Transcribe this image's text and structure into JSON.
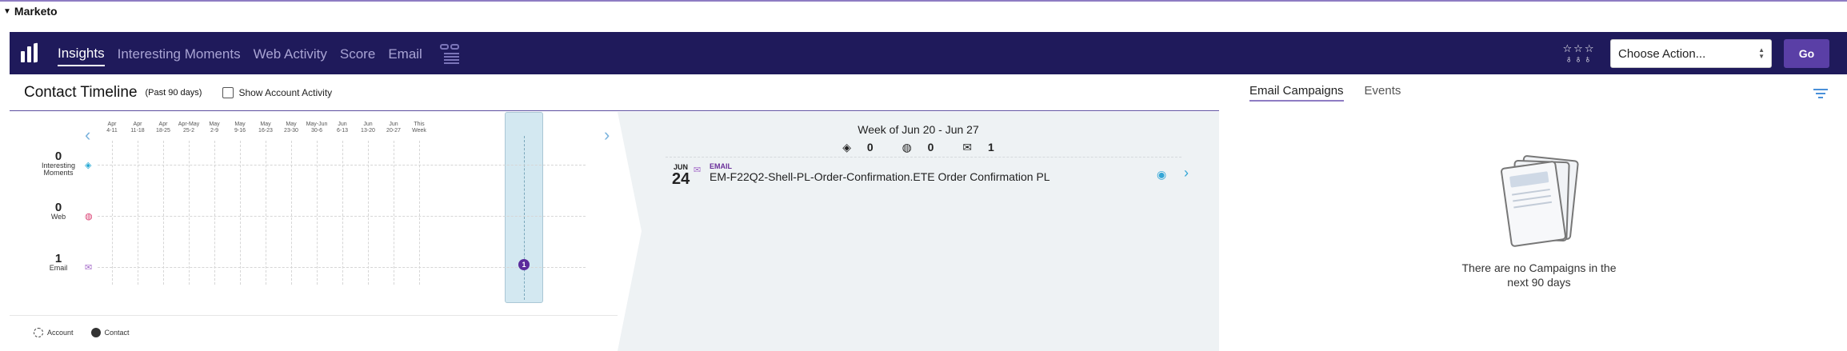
{
  "section": {
    "title": "Marketo"
  },
  "nav": {
    "tabs": [
      {
        "label": "Insights",
        "active": true
      },
      {
        "label": "Interesting Moments"
      },
      {
        "label": "Web Activity"
      },
      {
        "label": "Score"
      },
      {
        "label": "Email"
      }
    ],
    "action_select": {
      "value": "Choose Action..."
    },
    "go_label": "Go",
    "colors": {
      "bar": "#1f1a5b",
      "go": "#5a3fa6"
    }
  },
  "timeline": {
    "title": "Contact Timeline",
    "subtitle": "(Past 90 days)",
    "show_account_label": "Show Account Activity",
    "show_account_checked": false,
    "weeks": [
      {
        "top": "Apr",
        "bottom": "4-11"
      },
      {
        "top": "Apr",
        "bottom": "11-18"
      },
      {
        "top": "Apr",
        "bottom": "18-25"
      },
      {
        "top": "Apr-May",
        "bottom": "25-2"
      },
      {
        "top": "May",
        "bottom": "2-9"
      },
      {
        "top": "May",
        "bottom": "9-16"
      },
      {
        "top": "May",
        "bottom": "16-23"
      },
      {
        "top": "May",
        "bottom": "23-30"
      },
      {
        "top": "May-Jun",
        "bottom": "30-6"
      },
      {
        "top": "Jun",
        "bottom": "6-13"
      },
      {
        "top": "Jun",
        "bottom": "13-20"
      },
      {
        "top": "Jun",
        "bottom": "20-27"
      },
      {
        "top": "This",
        "bottom": "Week"
      }
    ],
    "selected_week_index": 11,
    "rows": [
      {
        "count": "0",
        "label": "Interesting Moments",
        "icon": "diamond-icon"
      },
      {
        "count": "0",
        "label": "Web",
        "icon": "globe-icon"
      },
      {
        "count": "1",
        "label": "Email",
        "icon": "envelope-icon"
      }
    ],
    "email_dot": "1",
    "legend": {
      "account": "Account",
      "contact": "Contact"
    }
  },
  "week_detail": {
    "title": "Week of Jun 20 - Jun 27",
    "stats": {
      "moments": "0",
      "web": "0",
      "email": "1"
    },
    "events": [
      {
        "month": "JUN",
        "day": "24",
        "type": "EMAIL",
        "name": "EM-F22Q2-Shell-PL-Order-Confirmation.ETE Order Confirmation PL"
      }
    ]
  },
  "campaigns": {
    "tabs": [
      {
        "label": "Email Campaigns",
        "active": true
      },
      {
        "label": "Events"
      }
    ],
    "empty_message": "There are no Campaigns in the next 90 days"
  }
}
